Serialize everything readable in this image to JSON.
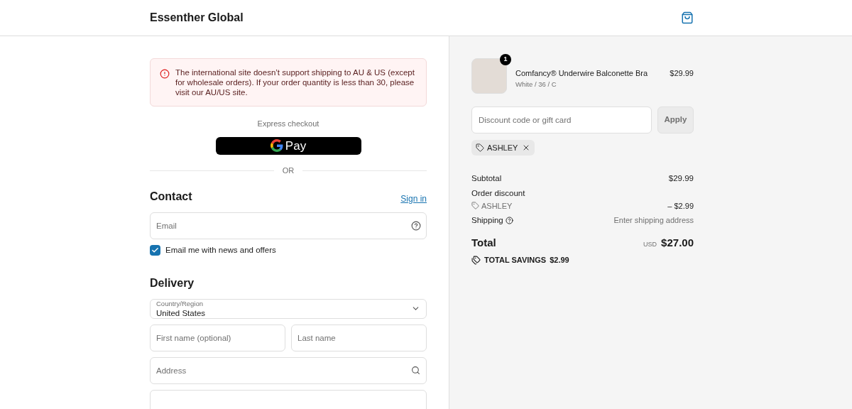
{
  "header": {
    "store_name": "Essenther Global"
  },
  "notice": {
    "text": "The international site doesn’t support shipping to AU & US (except for wholesale orders). If your order quantity is less than 30, please visit our AU/US site."
  },
  "express": {
    "label": "Express checkout",
    "pay_button": "Pay",
    "divider": "OR"
  },
  "contact": {
    "title": "Contact",
    "sign_in": "Sign in",
    "email": {
      "placeholder": "Email"
    },
    "newsletter": {
      "label": "Email me with news and offers",
      "checked": true
    }
  },
  "delivery": {
    "title": "Delivery",
    "country": {
      "label": "Country/Region",
      "value": "United States"
    },
    "first_name": {
      "placeholder": "First name (optional)"
    },
    "last_name": {
      "placeholder": "Last name"
    },
    "address": {
      "placeholder": "Address"
    }
  },
  "summary": {
    "item": {
      "name": "Comfancy® Underwire Balconette Bra",
      "variant": "White / 36 / C",
      "price": "$29.99",
      "quantity": "1"
    },
    "discount": {
      "placeholder": "Discount code or gift card",
      "button": "Apply",
      "tag": "ASHLEY"
    },
    "subtotal": {
      "label": "Subtotal",
      "value": "$29.99"
    },
    "order_discount": {
      "label": "Order discount",
      "code": "ASHLEY",
      "value": "– $2.99"
    },
    "shipping": {
      "label": "Shipping",
      "value": "Enter shipping address"
    },
    "total": {
      "label": "Total",
      "currency": "USD",
      "value": "$27.00"
    },
    "savings": {
      "label": "TOTAL SAVINGS",
      "value": "$2.99"
    }
  }
}
